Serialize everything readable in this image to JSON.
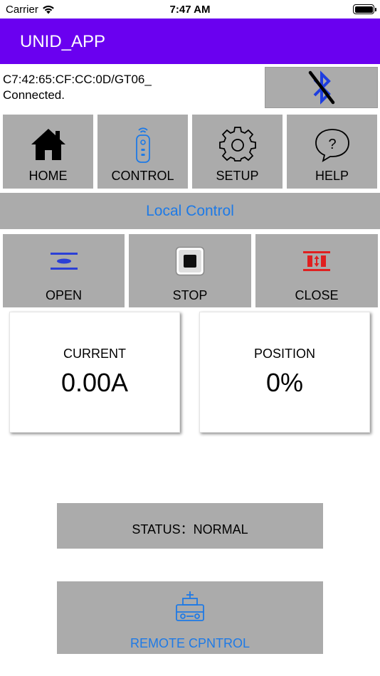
{
  "status_bar": {
    "carrier": "Carrier",
    "time": "7:47 AM"
  },
  "header": {
    "title": "UNID_APP",
    "background_color": "#6a00f0"
  },
  "device": {
    "address": "C7:42:65:CF:CC:0D/GT06_",
    "connection_status": "Connected.",
    "bluetooth_icon": "bluetooth-disabled-icon"
  },
  "nav": {
    "items": [
      {
        "label": "HOME",
        "icon": "home-icon"
      },
      {
        "label": "CONTROL",
        "icon": "remote-icon"
      },
      {
        "label": "SETUP",
        "icon": "gear-icon"
      },
      {
        "label": "HELP",
        "icon": "help-icon"
      }
    ]
  },
  "section": {
    "title": "Local Control",
    "accent_color": "#1e7ae6"
  },
  "controls": {
    "items": [
      {
        "label": "OPEN",
        "icon": "open-icon"
      },
      {
        "label": "STOP",
        "icon": "stop-icon"
      },
      {
        "label": "CLOSE",
        "icon": "close-icon"
      }
    ]
  },
  "metrics": {
    "current": {
      "label": "CURRENT",
      "value": "0.00A"
    },
    "position": {
      "label": "POSITION",
      "value": "0%"
    }
  },
  "status": {
    "text": "STATUS：NORMAL"
  },
  "remote": {
    "label": "REMOTE CPNTROL",
    "icon": "remote-control-icon"
  }
}
